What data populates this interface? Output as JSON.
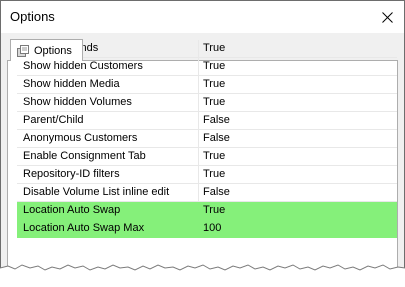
{
  "window": {
    "title": "Options"
  },
  "tabs": [
    {
      "label": "Options",
      "icon": "options-tab-icon"
    }
  ],
  "options": [
    {
      "name": "Disable sounds",
      "value": "True",
      "highlighted": false
    },
    {
      "name": "Show hidden Customers",
      "value": "True",
      "highlighted": false
    },
    {
      "name": "Show hidden Media",
      "value": "True",
      "highlighted": false
    },
    {
      "name": "Show hidden Volumes",
      "value": "True",
      "highlighted": false
    },
    {
      "name": "Parent/Child",
      "value": "False",
      "highlighted": false
    },
    {
      "name": "Anonymous Customers",
      "value": "False",
      "highlighted": false
    },
    {
      "name": "Enable Consignment Tab",
      "value": "True",
      "highlighted": false
    },
    {
      "name": "Repository-ID filters",
      "value": "True",
      "highlighted": false
    },
    {
      "name": "Disable Volume List inline edit",
      "value": "False",
      "highlighted": false
    },
    {
      "name": "Location Auto Swap",
      "value": "True",
      "highlighted": true
    },
    {
      "name": "Location Auto Swap Max",
      "value": "100",
      "highlighted": true
    }
  ],
  "colors": {
    "highlight": "#85f07a",
    "window_border": "#6d6d6d",
    "client_bg": "#f0f0f0"
  }
}
